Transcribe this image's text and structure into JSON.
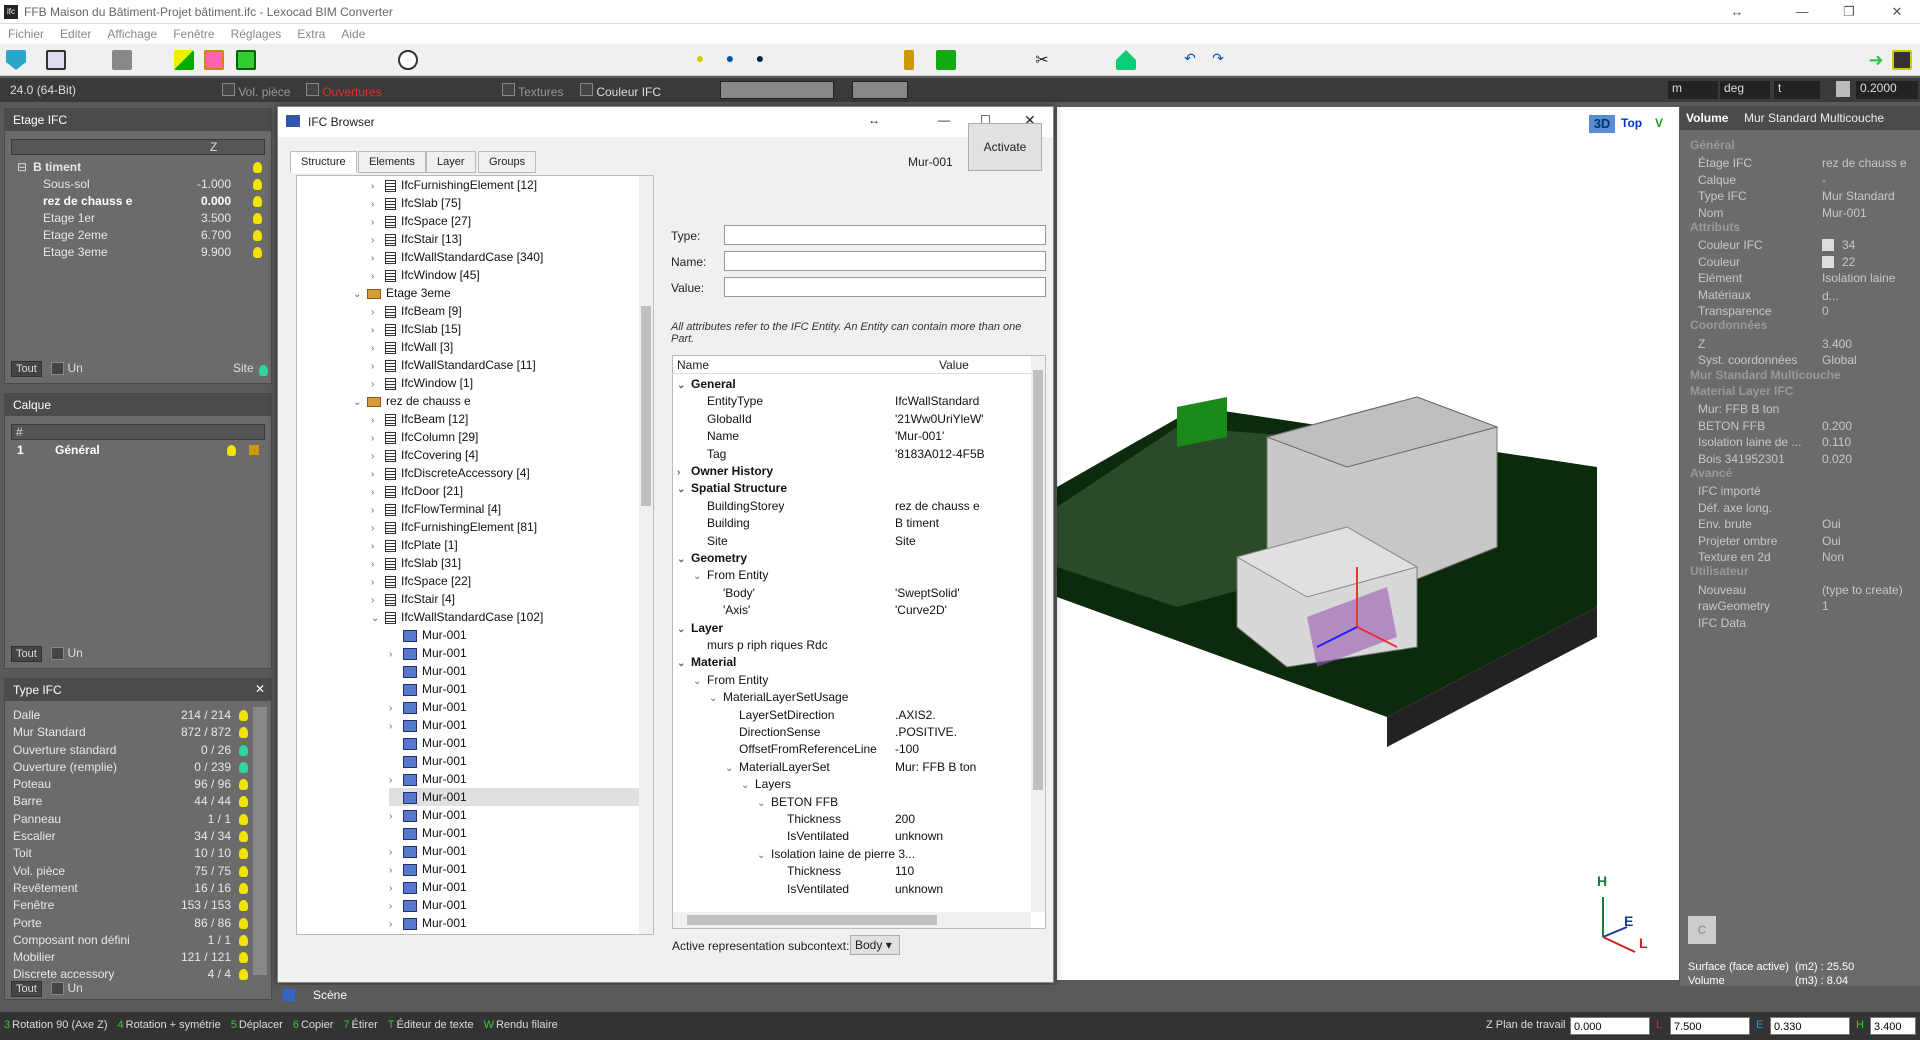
{
  "window": {
    "title": "FFB Maison du Bâtiment-Projet bâtiment.ifc - Lexocad BIM Converter",
    "logo": "ifc"
  },
  "menu": [
    "Fichier",
    "Editer",
    "Affichage",
    "Fenêtre",
    "Réglages",
    "Extra",
    "Aide"
  ],
  "subbar": {
    "version": "24.0 (64-Bit)",
    "vol_piece": "Vol. pièce",
    "ouvertures": "Ouvertures",
    "textures": "Textures",
    "couleur_ifc": "Couleur IFC",
    "unit": "m",
    "angle": "deg",
    "t": "t",
    "scale": "0.2000"
  },
  "etage_panel": {
    "title": "Etage IFC",
    "col_z": "Z",
    "root": "B timent",
    "rows": [
      {
        "name": "Sous-sol",
        "z": "-1.000",
        "bold": false
      },
      {
        "name": "rez de chauss e",
        "z": "0.000",
        "bold": true
      },
      {
        "name": "Etage 1er",
        "z": "3.500",
        "bold": false
      },
      {
        "name": "Etage 2eme",
        "z": "6.700",
        "bold": false
      },
      {
        "name": "Etage 3eme",
        "z": "9.900",
        "bold": false
      }
    ],
    "tout": "Tout",
    "un": "Un",
    "site": "Site"
  },
  "calque_panel": {
    "title": "Calque",
    "col_hash": "#",
    "row_num": "1",
    "row_name": "Général",
    "tout": "Tout",
    "un": "Un"
  },
  "type_panel": {
    "title": "Type IFC",
    "rows": [
      {
        "name": "Dalle",
        "count": "214 / 214"
      },
      {
        "name": "Mur Standard",
        "count": "872 / 872"
      },
      {
        "name": "Ouverture standard",
        "count": "0 / 26"
      },
      {
        "name": "Ouverture (remplie)",
        "count": "0 / 239"
      },
      {
        "name": "Poteau",
        "count": "96 / 96"
      },
      {
        "name": "Barre",
        "count": "44 / 44"
      },
      {
        "name": "Panneau",
        "count": "1 / 1"
      },
      {
        "name": "Escalier",
        "count": "34 / 34"
      },
      {
        "name": "Toit",
        "count": "10 / 10"
      },
      {
        "name": "Vol. pièce",
        "count": "75 / 75"
      },
      {
        "name": "Revêtement",
        "count": "16 / 16"
      },
      {
        "name": "Fenêtre",
        "count": "153 / 153"
      },
      {
        "name": "Porte",
        "count": "86 / 86"
      },
      {
        "name": "Composant non défini",
        "count": "1 / 1"
      },
      {
        "name": "Mobilier",
        "count": "121 / 121"
      },
      {
        "name": "Discrete accessory",
        "count": "4 / 4"
      }
    ],
    "tout": "Tout",
    "un": "Un"
  },
  "dialog": {
    "title": "IFC Browser",
    "tabs": [
      "Structure",
      "Elements",
      "Layer",
      "Groups"
    ],
    "entity": "Mur-001",
    "activate": "Activate",
    "type_label": "Type:",
    "name_label": "Name:",
    "value_label": "Value:",
    "note": "All attributes refer to the IFC Entity. An Entity can contain more than one Part.",
    "col_name": "Name",
    "col_value": "Value",
    "subcontext_label": "Active representation subcontext:",
    "subcontext_value": "Body"
  },
  "tree": [
    {
      "d": 4,
      "t": "IfcFurnishingElement [12]",
      "k": "ic",
      "a": "›"
    },
    {
      "d": 4,
      "t": "IfcSlab [75]",
      "k": "ic",
      "a": "›"
    },
    {
      "d": 4,
      "t": "IfcSpace [27]",
      "k": "ic",
      "a": "›"
    },
    {
      "d": 4,
      "t": "IfcStair [13]",
      "k": "ic",
      "a": "›"
    },
    {
      "d": 4,
      "t": "IfcWallStandardCase [340]",
      "k": "ic",
      "a": "›"
    },
    {
      "d": 4,
      "t": "IfcWindow [45]",
      "k": "ic",
      "a": "›"
    },
    {
      "d": 3,
      "t": "Etage 3eme",
      "k": "fold",
      "a": "⌄"
    },
    {
      "d": 4,
      "t": "IfcBeam [9]",
      "k": "ic",
      "a": "›"
    },
    {
      "d": 4,
      "t": "IfcSlab [15]",
      "k": "ic",
      "a": "›"
    },
    {
      "d": 4,
      "t": "IfcWall [3]",
      "k": "ic",
      "a": "›"
    },
    {
      "d": 4,
      "t": "IfcWallStandardCase [11]",
      "k": "ic",
      "a": "›"
    },
    {
      "d": 4,
      "t": "IfcWindow [1]",
      "k": "ic",
      "a": "›"
    },
    {
      "d": 3,
      "t": "rez de chauss e",
      "k": "fold",
      "a": "⌄"
    },
    {
      "d": 4,
      "t": "IfcBeam [12]",
      "k": "ic",
      "a": "›"
    },
    {
      "d": 4,
      "t": "IfcColumn [29]",
      "k": "ic",
      "a": "›"
    },
    {
      "d": 4,
      "t": "IfcCovering [4]",
      "k": "ic",
      "a": "›"
    },
    {
      "d": 4,
      "t": "IfcDiscreteAccessory [4]",
      "k": "ic",
      "a": "›"
    },
    {
      "d": 4,
      "t": "IfcDoor [21]",
      "k": "ic",
      "a": "›"
    },
    {
      "d": 4,
      "t": "IfcFlowTerminal [4]",
      "k": "ic",
      "a": "›"
    },
    {
      "d": 4,
      "t": "IfcFurnishingElement [81]",
      "k": "ic",
      "a": "›"
    },
    {
      "d": 4,
      "t": "IfcPlate [1]",
      "k": "ic",
      "a": "›"
    },
    {
      "d": 4,
      "t": "IfcSlab [31]",
      "k": "ic",
      "a": "›"
    },
    {
      "d": 4,
      "t": "IfcSpace [22]",
      "k": "ic",
      "a": "›"
    },
    {
      "d": 4,
      "t": "IfcStair [4]",
      "k": "ic",
      "a": "›"
    },
    {
      "d": 4,
      "t": "IfcWallStandardCase [102]",
      "k": "ic",
      "a": "⌄"
    },
    {
      "d": 5,
      "t": "Mur-001",
      "k": "ent",
      "a": ""
    },
    {
      "d": 5,
      "t": "Mur-001",
      "k": "ent",
      "a": "›"
    },
    {
      "d": 5,
      "t": "Mur-001",
      "k": "ent",
      "a": ""
    },
    {
      "d": 5,
      "t": "Mur-001",
      "k": "ent",
      "a": ""
    },
    {
      "d": 5,
      "t": "Mur-001",
      "k": "ent",
      "a": "›"
    },
    {
      "d": 5,
      "t": "Mur-001",
      "k": "ent",
      "a": "›"
    },
    {
      "d": 5,
      "t": "Mur-001",
      "k": "ent",
      "a": ""
    },
    {
      "d": 5,
      "t": "Mur-001",
      "k": "ent",
      "a": ""
    },
    {
      "d": 5,
      "t": "Mur-001",
      "k": "ent",
      "a": "›"
    },
    {
      "d": 5,
      "t": "Mur-001",
      "k": "ent",
      "a": "",
      "sel": true
    },
    {
      "d": 5,
      "t": "Mur-001",
      "k": "ent",
      "a": "›"
    },
    {
      "d": 5,
      "t": "Mur-001",
      "k": "ent",
      "a": ""
    },
    {
      "d": 5,
      "t": "Mur-001",
      "k": "ent",
      "a": "›"
    },
    {
      "d": 5,
      "t": "Mur-001",
      "k": "ent",
      "a": "›"
    },
    {
      "d": 5,
      "t": "Mur-001",
      "k": "ent",
      "a": "›"
    },
    {
      "d": 5,
      "t": "Mur-001",
      "k": "ent",
      "a": "›"
    },
    {
      "d": 5,
      "t": "Mur-001",
      "k": "ent",
      "a": "›"
    }
  ],
  "props": [
    {
      "d": 0,
      "n": "General",
      "v": "",
      "b": true,
      "a": "⌄"
    },
    {
      "d": 1,
      "n": "EntityType",
      "v": "IfcWallStandard"
    },
    {
      "d": 1,
      "n": "GlobalId",
      "v": "'21Ww0UriYleW'"
    },
    {
      "d": 1,
      "n": "Name",
      "v": "'Mur-001'"
    },
    {
      "d": 1,
      "n": "Tag",
      "v": "'8183A012-4F5B"
    },
    {
      "d": 0,
      "n": "Owner History",
      "v": "",
      "b": true,
      "a": "›"
    },
    {
      "d": 0,
      "n": "Spatial Structure",
      "v": "",
      "b": true,
      "a": "⌄"
    },
    {
      "d": 1,
      "n": "BuildingStorey",
      "v": "rez de chauss e"
    },
    {
      "d": 1,
      "n": "Building",
      "v": "B timent"
    },
    {
      "d": 1,
      "n": "Site",
      "v": "Site"
    },
    {
      "d": 0,
      "n": "Geometry",
      "v": "",
      "b": true,
      "a": "⌄"
    },
    {
      "d": 1,
      "n": "From Entity",
      "v": "",
      "a": "⌄"
    },
    {
      "d": 2,
      "n": "'Body'",
      "v": "'SweptSolid'"
    },
    {
      "d": 2,
      "n": "'Axis'",
      "v": "'Curve2D'"
    },
    {
      "d": 0,
      "n": "Layer",
      "v": "",
      "b": true,
      "a": "⌄"
    },
    {
      "d": 1,
      "n": "murs p riph riques Rdc",
      "v": ""
    },
    {
      "d": 0,
      "n": "Material",
      "v": "",
      "b": true,
      "a": "⌄"
    },
    {
      "d": 1,
      "n": "From Entity",
      "v": "",
      "a": "⌄"
    },
    {
      "d": 2,
      "n": "MaterialLayerSetUsage",
      "v": "",
      "a": "⌄"
    },
    {
      "d": 3,
      "n": "LayerSetDirection",
      "v": ".AXIS2."
    },
    {
      "d": 3,
      "n": "DirectionSense",
      "v": ".POSITIVE."
    },
    {
      "d": 3,
      "n": "OffsetFromReferenceLine",
      "v": "-100"
    },
    {
      "d": 3,
      "n": "MaterialLayerSet",
      "v": "Mur: FFB B ton",
      "a": "⌄"
    },
    {
      "d": 4,
      "n": "Layers",
      "v": "",
      "a": "⌄"
    },
    {
      "d": 5,
      "n": "BETON FFB",
      "v": "",
      "a": "⌄"
    },
    {
      "d": 6,
      "n": "Thickness",
      "v": "200"
    },
    {
      "d": 6,
      "n": "IsVentilated",
      "v": "unknown"
    },
    {
      "d": 5,
      "n": "Isolation laine de pierre 3...",
      "v": "",
      "a": "⌄"
    },
    {
      "d": 6,
      "n": "Thickness",
      "v": "110"
    },
    {
      "d": 6,
      "n": "IsVentilated",
      "v": "unknown"
    }
  ],
  "viewport": {
    "view3d": "3D",
    "top": "Top",
    "v": "V",
    "axis_h": "H",
    "axis_e": "E",
    "axis_l": "L"
  },
  "right_panel": {
    "header_label": "Volume",
    "header_value": "Mur Standard Multicouche",
    "sections": [
      {
        "title": "Général",
        "rows": [
          {
            "n": "Étage IFC",
            "v": "rez de chauss e"
          },
          {
            "n": "Calque",
            "v": "-"
          },
          {
            "n": "Type IFC",
            "v": "Mur Standard"
          },
          {
            "n": "Nom",
            "v": "Mur-001"
          }
        ]
      },
      {
        "title": "Attributs",
        "rows": [
          {
            "n": "Couleur IFC",
            "v": "34"
          },
          {
            "n": "Couleur",
            "v": "22"
          },
          {
            "n": "Elément",
            "v": "Isolation laine d..."
          },
          {
            "n": "Matériaux",
            "v": ""
          },
          {
            "n": "Transparence",
            "v": "0"
          }
        ]
      },
      {
        "title": "Coordonnées",
        "rows": [
          {
            "n": "Z",
            "v": "3.400"
          },
          {
            "n": "Syst. coordonnées",
            "v": "Global"
          }
        ]
      },
      {
        "title": "Mur Standard Multicouche",
        "rows": []
      },
      {
        "title": "Material Layer IFC",
        "rows": [
          {
            "n": "Mur: FFB B ton",
            "v": ""
          },
          {
            "n": "BETON FFB",
            "v": "0.200"
          },
          {
            "n": "Isolation laine de ...",
            "v": "0.110"
          },
          {
            "n": "Bois 341952301",
            "v": "0.020"
          }
        ]
      },
      {
        "title": "Avancé",
        "rows": [
          {
            "n": "IFC importé",
            "v": ""
          },
          {
            "n": "Déf. axe long.",
            "v": ""
          },
          {
            "n": "Env. brute",
            "v": "Oui"
          },
          {
            "n": "Projeter ombre",
            "v": "Oui"
          },
          {
            "n": "Texture en 2d",
            "v": "Non"
          }
        ]
      },
      {
        "title": "Utilisateur",
        "rows": [
          {
            "n": "Nouveau",
            "v": "(type to create)"
          },
          {
            "n": "rawGeometry",
            "v": "1"
          },
          {
            "n": "IFC Data",
            "v": ""
          }
        ]
      }
    ],
    "surface": "Surface (face active)  (m2) : 25.50",
    "volume": "Volume                       (m3) : 8.04"
  },
  "scene_tab": "Scène",
  "status": {
    "items": [
      {
        "k": "3",
        "t": "Rotation 90 (Axe Z)"
      },
      {
        "k": "4",
        "t": "Rotation + symétrie"
      },
      {
        "k": "5",
        "t": "Déplacer"
      },
      {
        "k": "6",
        "t": "Copier"
      },
      {
        "k": "7",
        "t": "Étirer"
      },
      {
        "k": "T",
        "t": "Éditeur de texte"
      },
      {
        "k": "W",
        "t": "Rendu filaire"
      }
    ],
    "zplan_label": "Z Plan de travail",
    "zplan": "0.000",
    "l_label": "L",
    "l": "7.500",
    "e_label": "E",
    "e": "0.330",
    "h_label": "H",
    "h": "3.400"
  },
  "colors": {
    "accent_green": "#3cc43c",
    "bulb": "#f2e300",
    "panel": "#6b6b6b",
    "selection": "#cce8ff"
  }
}
